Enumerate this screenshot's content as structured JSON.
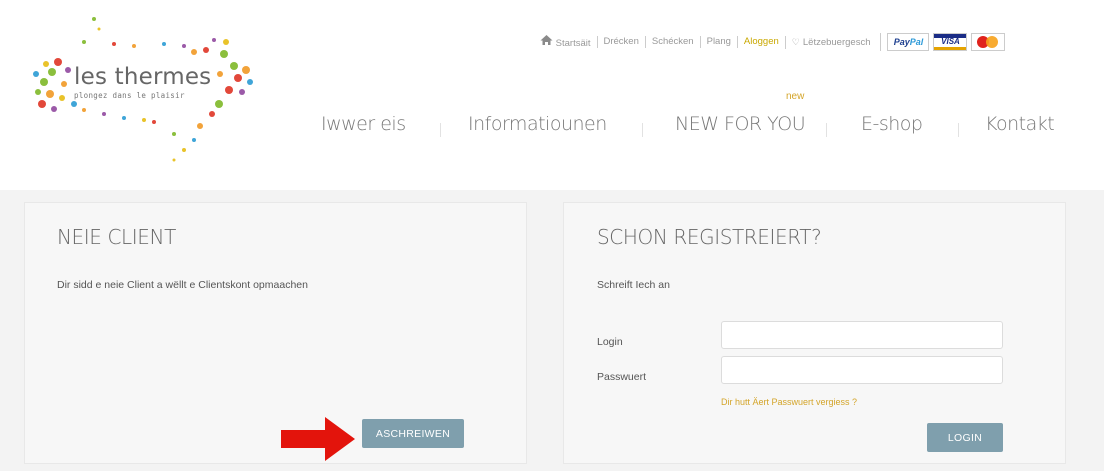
{
  "brand": {
    "name": "les thermes",
    "tagline": "plongez dans le plaisir"
  },
  "top_nav": {
    "items": [
      {
        "label": "Startsäit",
        "icon": "home-icon"
      },
      {
        "label": "Drécken"
      },
      {
        "label": "Schécken"
      },
      {
        "label": "Plang"
      },
      {
        "label": "Aloggen",
        "active": true
      },
      {
        "label": "Lëtzebuergesch",
        "icon": "heart-icon"
      }
    ],
    "payment": [
      "PayPal",
      "VISA",
      "MasterCard"
    ]
  },
  "main_nav": {
    "items": [
      {
        "label": "Iwwer eis"
      },
      {
        "label": "Informatiounen"
      },
      {
        "label": "NEW FOR YOU",
        "badge": "new"
      },
      {
        "label": "E-shop"
      },
      {
        "label": "Kontakt"
      }
    ]
  },
  "new_client": {
    "title": "NEIE CLIENT",
    "text": "Dir sidd e neie Client a wëllt e Clientskont opmaachen",
    "button": "ASCHREIWEN"
  },
  "login": {
    "title": "SCHON REGISTREIERT?",
    "text": "Schreift Iech an",
    "login_label": "Login",
    "login_value": "",
    "password_label": "Passwuert",
    "password_value": "",
    "forgot": "Dir hutt Äert Passwuert vergiess ?",
    "button": "LOGIN"
  },
  "colors": {
    "button": "#7f9fad",
    "accent": "#d4a52a",
    "arrow": "#e3140c"
  }
}
